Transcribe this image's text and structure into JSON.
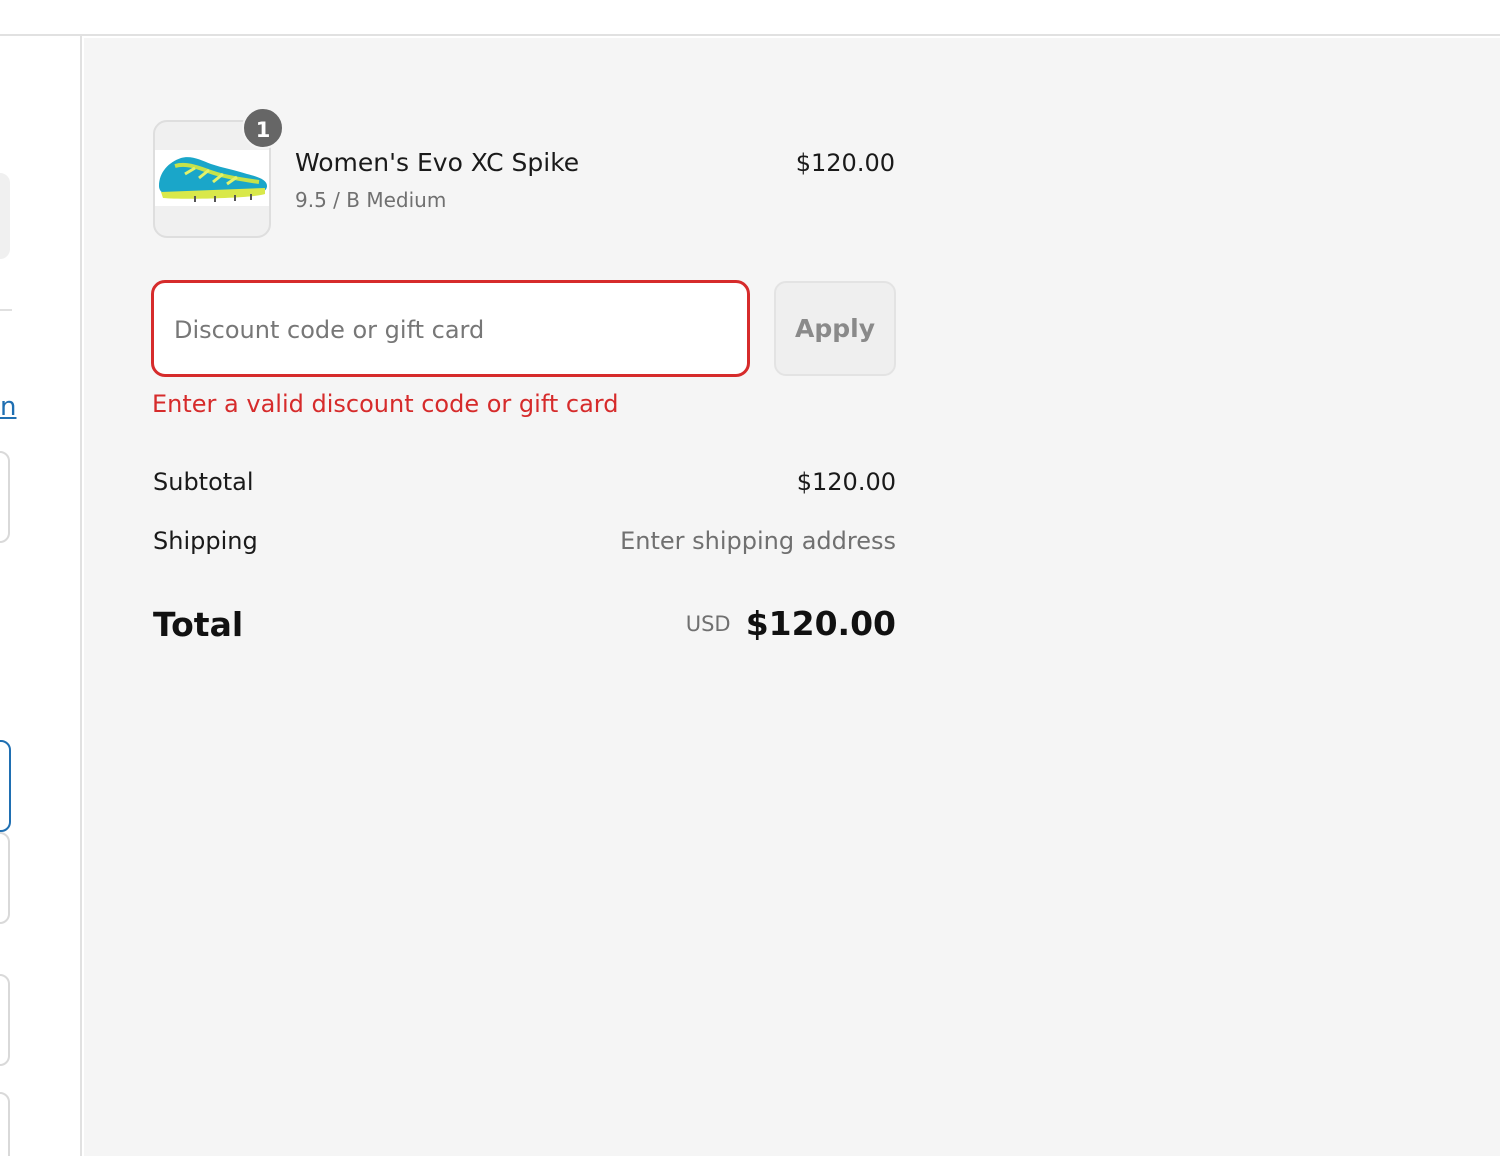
{
  "cart": {
    "items": [
      {
        "quantity": "1",
        "name": "Women's Evo XC Spike",
        "variant": "9.5 / B Medium",
        "price": "$120.00",
        "image_icon": "running-spike-shoe-image"
      }
    ]
  },
  "discount": {
    "placeholder": "Discount code or gift card",
    "value": "",
    "apply_label": "Apply",
    "error": "Enter a valid discount code or gift card"
  },
  "totals": {
    "subtotal_label": "Subtotal",
    "subtotal_value": "$120.00",
    "shipping_label": "Shipping",
    "shipping_value": "Enter shipping address",
    "total_label": "Total",
    "currency": "USD",
    "total_value": "$120.00"
  },
  "left_panel": {
    "link_fragment": "n"
  },
  "colors": {
    "error": "#d62b2b",
    "summary_bg": "#f5f5f5",
    "badge": "#666666"
  }
}
